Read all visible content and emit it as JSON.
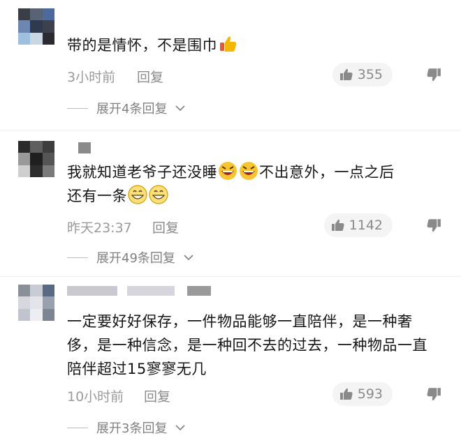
{
  "comments": [
    {
      "text": "带的是情怀，不是围巾",
      "time": "3小时前",
      "reply_label": "回复",
      "likes": "355",
      "expand_label": "展开4条回复"
    },
    {
      "text_line1": "我就知道老爷子还没睡",
      "text_line1_end": "不出意外，一点之后",
      "text_line2": "还有一条",
      "time": "昨天23:37",
      "reply_label": "回复",
      "likes": "1142",
      "expand_label": "展开49条回复"
    },
    {
      "text": "一定要好好保存，一件物品能够一直陪伴，是一种奢侈，是一种信念，是一种回不去的过去，一种物品一直陪伴超过15寥寥无几",
      "time": "10小时前",
      "reply_label": "回复",
      "likes": "593",
      "expand_label": "展开3条回复"
    }
  ],
  "icons": {
    "like": "thumbs-up-icon",
    "dislike": "thumbs-down-icon",
    "expand": "chevron-down-icon"
  },
  "colors": {
    "muted": "#9a9a9a",
    "like_bg": "#f4f4f4",
    "thumbs_emoji": "#f5b800"
  }
}
